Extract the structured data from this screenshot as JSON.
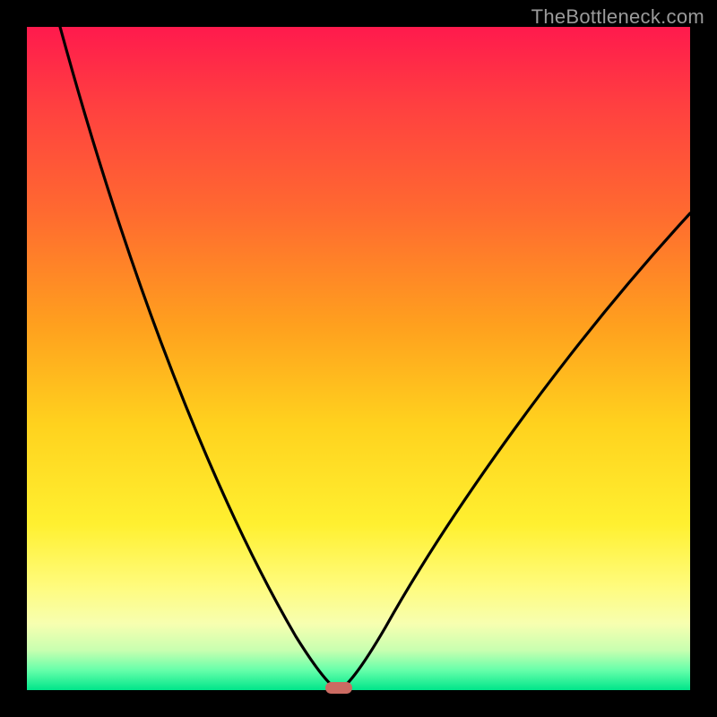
{
  "watermark": "TheBottleneck.com",
  "chart_data": {
    "type": "line",
    "title": "",
    "xlabel": "",
    "ylabel": "",
    "xlim": [
      0,
      100
    ],
    "ylim": [
      0,
      100
    ],
    "curve": {
      "left_start": {
        "x": 5,
        "y": 100
      },
      "vertex": {
        "x": 47,
        "y": 0
      },
      "right_end": {
        "x": 100,
        "y": 72
      }
    },
    "marker_x_range": [
      45,
      49
    ],
    "gradient_stops": [
      {
        "pos": 0,
        "color": "#ff1a4d"
      },
      {
        "pos": 12,
        "color": "#ff4040"
      },
      {
        "pos": 28,
        "color": "#ff6a30"
      },
      {
        "pos": 45,
        "color": "#ffa01e"
      },
      {
        "pos": 60,
        "color": "#ffd21e"
      },
      {
        "pos": 75,
        "color": "#fff030"
      },
      {
        "pos": 84,
        "color": "#fffb7a"
      },
      {
        "pos": 90,
        "color": "#f7ffb0"
      },
      {
        "pos": 94,
        "color": "#c8ffb0"
      },
      {
        "pos": 97,
        "color": "#66ffaa"
      },
      {
        "pos": 100,
        "color": "#00e58a"
      }
    ]
  }
}
